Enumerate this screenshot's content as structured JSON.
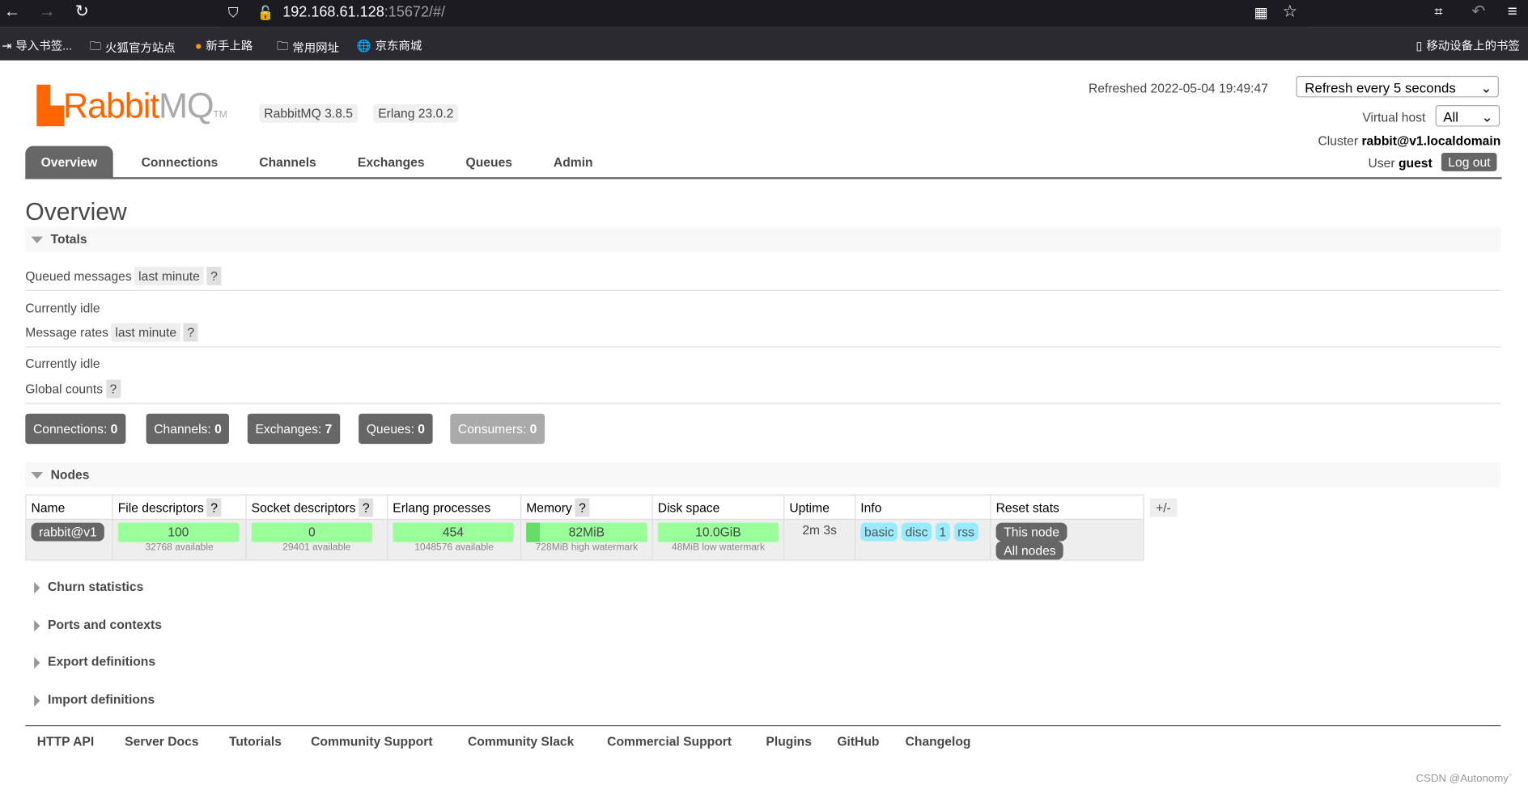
{
  "browser": {
    "url_host": "192.168.61.128",
    "url_rest": ":15672/#/",
    "bookmarks": [
      "导入书签...",
      "火狐官方站点",
      "新手上路",
      "常用网址",
      "京东商城"
    ],
    "mobile_bookmarks": "移动设备上的书签"
  },
  "header": {
    "logo": "RabbitMQ",
    "rabbitmq_version": "RabbitMQ 3.8.5",
    "erlang_version": "Erlang 23.0.2",
    "refreshed": "Refreshed 2022-05-04 19:49:47",
    "refresh_select": "Refresh every 5 seconds",
    "vhost_label": "Virtual host",
    "vhost_value": "All",
    "cluster_label": "Cluster",
    "cluster_value": "rabbit@v1.localdomain",
    "user_label": "User",
    "user_value": "guest",
    "logout": "Log out"
  },
  "tabs": [
    "Overview",
    "Connections",
    "Channels",
    "Exchanges",
    "Queues",
    "Admin"
  ],
  "page_title": "Overview",
  "totals": {
    "title": "Totals",
    "queued_label": "Queued messages",
    "last_minute": "last minute",
    "help": "?",
    "idle": "Currently idle",
    "rates_label": "Message rates",
    "global_label": "Global counts",
    "counts": [
      {
        "label": "Connections:",
        "value": "0"
      },
      {
        "label": "Channels:",
        "value": "0"
      },
      {
        "label": "Exchanges:",
        "value": "7"
      },
      {
        "label": "Queues:",
        "value": "0"
      },
      {
        "label": "Consumers:",
        "value": "0"
      }
    ]
  },
  "nodes": {
    "title": "Nodes",
    "headers": [
      "Name",
      "File descriptors",
      "Socket descriptors",
      "Erlang processes",
      "Memory",
      "Disk space",
      "Uptime",
      "Info",
      "Reset stats"
    ],
    "plusminus": "+/-",
    "row": {
      "name": "rabbit@v1",
      "fd": "100",
      "fd_sub": "32768 available",
      "sd": "0",
      "sd_sub": "29401 available",
      "ep": "454",
      "ep_sub": "1048576 available",
      "mem": "82MiB",
      "mem_sub": "728MiB high watermark",
      "mem_fraction": 0.11,
      "disk": "10.0GiB",
      "disk_sub": "48MiB low watermark",
      "uptime": "2m 3s",
      "info": [
        "basic",
        "disc",
        "1",
        "rss"
      ],
      "this_node": "This node",
      "all_nodes": "All nodes"
    }
  },
  "sections": [
    "Churn statistics",
    "Ports and contexts",
    "Export definitions",
    "Import definitions"
  ],
  "footer": [
    "HTTP API",
    "Server Docs",
    "Tutorials",
    "Community Support",
    "Community Slack",
    "Commercial Support",
    "Plugins",
    "GitHub",
    "Changelog"
  ],
  "watermark": "CSDN @Autonomy`"
}
